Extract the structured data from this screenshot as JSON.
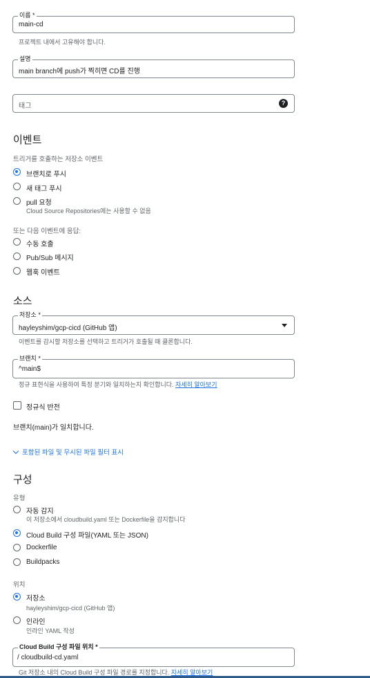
{
  "name_field": {
    "label": "이름 *",
    "value": "main-cd",
    "helper": "프로젝트 내에서 고유해야 합니다."
  },
  "description_field": {
    "label": "설명",
    "value": "main branch에 push가 찍히면 CD를 진행"
  },
  "tag_field": {
    "placeholder": "태그"
  },
  "events": {
    "title": "이벤트",
    "trigger_label": "트리거를 호출하는 저장소 이벤트",
    "options": [
      {
        "label": "브랜치로 푸시",
        "selected": true
      },
      {
        "label": "새 태그 푸시",
        "selected": false
      },
      {
        "label": "pull 요청",
        "desc": "Cloud Source Repositories에는 사용할 수 없음",
        "selected": false
      }
    ],
    "respond_label": "또는 다음 이벤트에 응답:",
    "respond_options": [
      {
        "label": "수동 호출"
      },
      {
        "label": "Pub/Sub 메시지"
      },
      {
        "label": "웹훅 이벤트"
      }
    ]
  },
  "source": {
    "title": "소스",
    "repo_label": "저장소 *",
    "repo_value": "hayleyshim/gcp-cicd (GitHub 앱)",
    "repo_helper": "이벤트를 감시할 저장소를 선택하고 트리거가 호출될 때 클론합니다.",
    "branch_label": "브랜치 *",
    "branch_value": "^main$",
    "branch_helper": "정규 표현식을 사용하여 특정 분기와 일치하는지 확인합니다.",
    "branch_helper_link": "자세히 알아보기",
    "invert_label": "정규식 반전",
    "match_text": "브랜치(main)가 일치합니다.",
    "filter_toggle": "포함된 파일 및 무시된 파일 필터 표시"
  },
  "config": {
    "title": "구성",
    "type_label": "유형",
    "type_options": [
      {
        "label": "자동 감지",
        "desc": "이 저장소에서 cloudbuild.yaml 또는 Dockerfile을 감지합니다",
        "selected": false
      },
      {
        "label": "Cloud Build 구성 파일(YAML 또는 JSON)",
        "selected": true
      },
      {
        "label": "Dockerfile",
        "selected": false
      },
      {
        "label": "Buildpacks",
        "selected": false
      }
    ],
    "location_label": "위치",
    "location_options": [
      {
        "label": "저장소",
        "desc": "hayleyshim/gcp-cicd (GitHub 앱)",
        "selected": true
      },
      {
        "label": "인라인",
        "desc": "인라인 YAML 작성",
        "selected": false
      }
    ],
    "file_label": "Cloud Build 구성 파일 위치 *",
    "file_prefix": "/",
    "file_value": "cloudbuild-cd.yaml",
    "file_helper": "Git 저장소 내의 Cloud Build 구성 파일 경로를 지정합니다.",
    "file_helper_link": "자세히 알아보기"
  },
  "colors": {
    "accent": "#1a73e8",
    "text": "#202124",
    "muted": "#5f6368",
    "border": "#80868b"
  }
}
